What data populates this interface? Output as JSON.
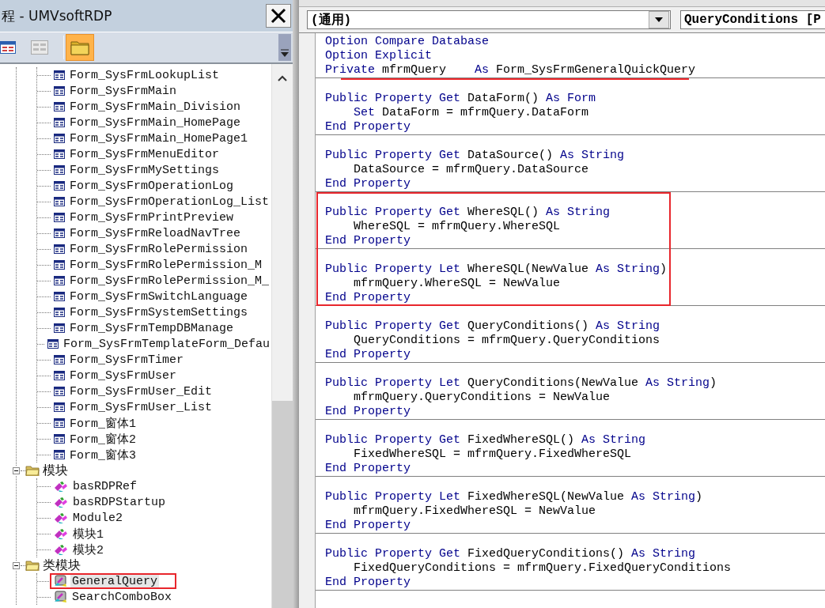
{
  "project_pane": {
    "title": "程 - UMVsoftRDP",
    "toolbar": [
      {
        "kind": "view-object",
        "selected": false
      },
      {
        "kind": "view-code",
        "selected": false
      },
      {
        "kind": "toggle-folders",
        "selected": true
      }
    ],
    "tree": [
      {
        "kind": "continued",
        "children": [
          {
            "label": "Form_SysFrmLookupList",
            "kind": "form",
            "selected": false
          },
          {
            "label": "Form_SysFrmMain",
            "kind": "form",
            "selected": false
          },
          {
            "label": "Form_SysFrmMain_Division",
            "kind": "form",
            "selected": false
          },
          {
            "label": "Form_SysFrmMain_HomePage",
            "kind": "form",
            "selected": false
          },
          {
            "label": "Form_SysFrmMain_HomePage1",
            "kind": "form",
            "selected": false
          },
          {
            "label": "Form_SysFrmMenuEditor",
            "kind": "form",
            "selected": false
          },
          {
            "label": "Form_SysFrmMySettings",
            "kind": "form",
            "selected": false
          },
          {
            "label": "Form_SysFrmOperationLog",
            "kind": "form",
            "selected": false
          },
          {
            "label": "Form_SysFrmOperationLog_List",
            "kind": "form",
            "selected": false
          },
          {
            "label": "Form_SysFrmPrintPreview",
            "kind": "form",
            "selected": false
          },
          {
            "label": "Form_SysFrmReloadNavTree",
            "kind": "form",
            "selected": false
          },
          {
            "label": "Form_SysFrmRolePermission",
            "kind": "form",
            "selected": false
          },
          {
            "label": "Form_SysFrmRolePermission_M",
            "kind": "form",
            "selected": false
          },
          {
            "label": "Form_SysFrmRolePermission_M_",
            "kind": "form",
            "selected": false
          },
          {
            "label": "Form_SysFrmSwitchLanguage",
            "kind": "form",
            "selected": false
          },
          {
            "label": "Form_SysFrmSystemSettings",
            "kind": "form",
            "selected": false
          },
          {
            "label": "Form_SysFrmTempDBManage",
            "kind": "form",
            "selected": false
          },
          {
            "label": "Form_SysFrmTemplateForm_Defau",
            "kind": "form",
            "selected": false
          },
          {
            "label": "Form_SysFrmTimer",
            "kind": "form",
            "selected": false
          },
          {
            "label": "Form_SysFrmUser",
            "kind": "form",
            "selected": false
          },
          {
            "label": "Form_SysFrmUser_Edit",
            "kind": "form",
            "selected": false
          },
          {
            "label": "Form_SysFrmUser_List",
            "kind": "form",
            "selected": false
          },
          {
            "label": "Form_窗体1",
            "kind": "form",
            "selected": false
          },
          {
            "label": "Form_窗体2",
            "kind": "form",
            "selected": false
          },
          {
            "label": "Form_窗体3",
            "kind": "form",
            "selected": false
          }
        ]
      },
      {
        "kind": "folder",
        "label": "模块",
        "expanded": true,
        "children": [
          {
            "label": "basRDPRef",
            "kind": "module",
            "selected": false
          },
          {
            "label": "basRDPStartup",
            "kind": "module",
            "selected": false
          },
          {
            "label": "Module2",
            "kind": "module",
            "selected": false
          },
          {
            "label": "模块1",
            "kind": "module",
            "selected": false
          },
          {
            "label": "模块2",
            "kind": "module",
            "selected": false
          }
        ]
      },
      {
        "kind": "folder",
        "label": "类模块",
        "expanded": true,
        "children": [
          {
            "label": "GeneralQuery",
            "kind": "class",
            "selected": true,
            "marked": true
          },
          {
            "label": "SearchComboBox",
            "kind": "class",
            "selected": false,
            "marked": false
          }
        ]
      }
    ]
  },
  "code_pane": {
    "object_combo": "(通用)",
    "procedure_combo": "QueryConditions [P",
    "groups": [
      {
        "boxed": false,
        "procedures": [
          {
            "lines": [
              {
                "segments": [
                  {
                    "text": "Option Compare Database",
                    "kind": "keyword"
                  }
                ]
              },
              {
                "segments": [
                  {
                    "text": "Option Explicit",
                    "kind": "keyword"
                  }
                ]
              },
              {
                "underline": true,
                "segments": [
                  {
                    "text": "Private",
                    "kind": "keyword"
                  },
                  {
                    "text": " mfrmQuery    ",
                    "kind": "plain"
                  },
                  {
                    "text": "As",
                    "kind": "keyword"
                  },
                  {
                    "text": " Form_SysFrmGeneralQuickQuery",
                    "kind": "plain"
                  }
                ]
              }
            ]
          },
          {
            "lines": [
              {
                "segments": [
                  {
                    "text": "Public Property Get",
                    "kind": "keyword"
                  },
                  {
                    "text": " DataForm() ",
                    "kind": "plain"
                  },
                  {
                    "text": "As Form",
                    "kind": "keyword"
                  }
                ]
              },
              {
                "segments": [
                  {
                    "text": "    Set",
                    "kind": "keyword"
                  },
                  {
                    "text": " DataForm = mfrmQuery.DataForm",
                    "kind": "plain"
                  }
                ]
              },
              {
                "segments": [
                  {
                    "text": "End Property",
                    "kind": "keyword"
                  }
                ]
              }
            ]
          },
          {
            "lines": [
              {
                "segments": [
                  {
                    "text": "Public Property Get",
                    "kind": "keyword"
                  },
                  {
                    "text": " DataSource() ",
                    "kind": "plain"
                  },
                  {
                    "text": "As String",
                    "kind": "keyword"
                  }
                ]
              },
              {
                "segments": [
                  {
                    "text": "    DataSource = mfrmQuery.DataSource",
                    "kind": "plain"
                  }
                ]
              },
              {
                "segments": [
                  {
                    "text": "End Property",
                    "kind": "keyword"
                  }
                ]
              }
            ]
          }
        ]
      },
      {
        "boxed": true,
        "procedures": [
          {
            "lines": [
              {
                "segments": [
                  {
                    "text": "Public Property Get",
                    "kind": "keyword"
                  },
                  {
                    "text": " WhereSQL() ",
                    "kind": "plain"
                  },
                  {
                    "text": "As String",
                    "kind": "keyword"
                  }
                ]
              },
              {
                "segments": [
                  {
                    "text": "    WhereSQL = mfrmQuery.WhereSQL",
                    "kind": "plain"
                  }
                ]
              },
              {
                "segments": [
                  {
                    "text": "End Property",
                    "kind": "keyword"
                  }
                ]
              }
            ]
          },
          {
            "lines": [
              {
                "segments": [
                  {
                    "text": "Public Property Let",
                    "kind": "keyword"
                  },
                  {
                    "text": " WhereSQL(NewValue ",
                    "kind": "plain"
                  },
                  {
                    "text": "As String",
                    "kind": "keyword"
                  },
                  {
                    "text": ")",
                    "kind": "plain"
                  }
                ]
              },
              {
                "segments": [
                  {
                    "text": "    mfrmQuery.WhereSQL = NewValue",
                    "kind": "plain"
                  }
                ]
              },
              {
                "segments": [
                  {
                    "text": "End Property",
                    "kind": "keyword"
                  }
                ]
              }
            ]
          }
        ]
      },
      {
        "boxed": false,
        "procedures": [
          {
            "lines": [
              {
                "segments": [
                  {
                    "text": "Public Property Get",
                    "kind": "keyword"
                  },
                  {
                    "text": " QueryConditions() ",
                    "kind": "plain"
                  },
                  {
                    "text": "As String",
                    "kind": "keyword"
                  }
                ]
              },
              {
                "segments": [
                  {
                    "text": "    QueryConditions = mfrmQuery.QueryConditions",
                    "kind": "plain"
                  }
                ]
              },
              {
                "segments": [
                  {
                    "text": "End Property",
                    "kind": "keyword"
                  }
                ]
              }
            ]
          },
          {
            "lines": [
              {
                "segments": [
                  {
                    "text": "Public Property Let",
                    "kind": "keyword"
                  },
                  {
                    "text": " QueryConditions(NewValue ",
                    "kind": "plain"
                  },
                  {
                    "text": "As String",
                    "kind": "keyword"
                  },
                  {
                    "text": ")",
                    "kind": "plain"
                  }
                ]
              },
              {
                "segments": [
                  {
                    "text": "    mfrmQuery.QueryConditions = NewValue",
                    "kind": "plain"
                  }
                ]
              },
              {
                "segments": [
                  {
                    "text": "End Property",
                    "kind": "keyword"
                  }
                ]
              }
            ]
          },
          {
            "lines": [
              {
                "segments": [
                  {
                    "text": "Public Property Get",
                    "kind": "keyword"
                  },
                  {
                    "text": " FixedWhereSQL() ",
                    "kind": "plain"
                  },
                  {
                    "text": "As String",
                    "kind": "keyword"
                  }
                ]
              },
              {
                "segments": [
                  {
                    "text": "    FixedWhereSQL = mfrmQuery.FixedWhereSQL",
                    "kind": "plain"
                  }
                ]
              },
              {
                "segments": [
                  {
                    "text": "End Property",
                    "kind": "keyword"
                  }
                ]
              }
            ]
          },
          {
            "lines": [
              {
                "segments": [
                  {
                    "text": "Public Property Let",
                    "kind": "keyword"
                  },
                  {
                    "text": " FixedWhereSQL(NewValue ",
                    "kind": "plain"
                  },
                  {
                    "text": "As String",
                    "kind": "keyword"
                  },
                  {
                    "text": ")",
                    "kind": "plain"
                  }
                ]
              },
              {
                "segments": [
                  {
                    "text": "    mfrmQuery.FixedWhereSQL = NewValue",
                    "kind": "plain"
                  }
                ]
              },
              {
                "segments": [
                  {
                    "text": "End Property",
                    "kind": "keyword"
                  }
                ]
              }
            ]
          },
          {
            "lines": [
              {
                "segments": [
                  {
                    "text": "Public Property Get",
                    "kind": "keyword"
                  },
                  {
                    "text": " FixedQueryConditions() ",
                    "kind": "plain"
                  },
                  {
                    "text": "As String",
                    "kind": "keyword"
                  }
                ]
              },
              {
                "segments": [
                  {
                    "text": "    FixedQueryConditions = mfrmQuery.FixedQueryConditions",
                    "kind": "plain"
                  }
                ]
              },
              {
                "segments": [
                  {
                    "text": "End Property",
                    "kind": "keyword"
                  }
                ]
              }
            ]
          }
        ]
      }
    ]
  }
}
